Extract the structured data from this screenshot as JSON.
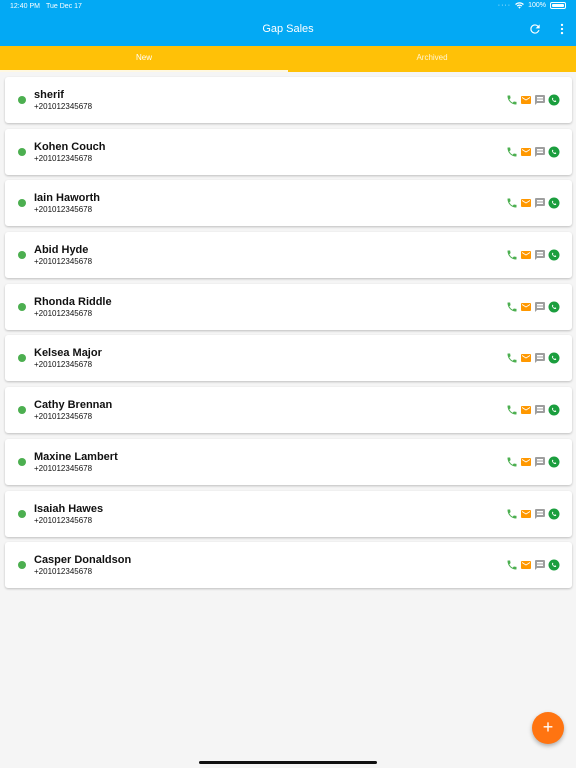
{
  "status_bar": {
    "time": "12:40 PM",
    "date": "Tue Dec 17",
    "battery": "100%"
  },
  "app": {
    "title": "Gap Sales"
  },
  "tabs": [
    {
      "label": "New",
      "active": true
    },
    {
      "label": "Archived",
      "active": false
    }
  ],
  "contacts": [
    {
      "name": "sherif",
      "phone": "+201012345678"
    },
    {
      "name": "Kohen Couch",
      "phone": "+201012345678"
    },
    {
      "name": "Iain Haworth",
      "phone": "+201012345678"
    },
    {
      "name": "Abid Hyde",
      "phone": "+201012345678"
    },
    {
      "name": "Rhonda Riddle",
      "phone": "+201012345678"
    },
    {
      "name": "Kelsea Major",
      "phone": "+201012345678"
    },
    {
      "name": "Cathy Brennan",
      "phone": "+201012345678"
    },
    {
      "name": "Maxine Lambert",
      "phone": "+201012345678"
    },
    {
      "name": "Isaiah Hawes",
      "phone": "+201012345678"
    },
    {
      "name": "Casper Donaldson",
      "phone": "+201012345678"
    }
  ],
  "icons": {
    "call": "phone-icon",
    "email": "mail-icon",
    "sms": "message-icon",
    "whatsapp": "whatsapp-icon",
    "add": "plus-icon"
  },
  "fab": {
    "label": "+"
  },
  "colors": {
    "appbar": "#03a9f4",
    "tabs": "#ffc107",
    "status_online": "#4caf50",
    "call": "#4caf50",
    "email": "#ff9800",
    "sms": "#9e9e9e",
    "whatsapp": "#1b9e3e",
    "fab": "#ff7411"
  }
}
